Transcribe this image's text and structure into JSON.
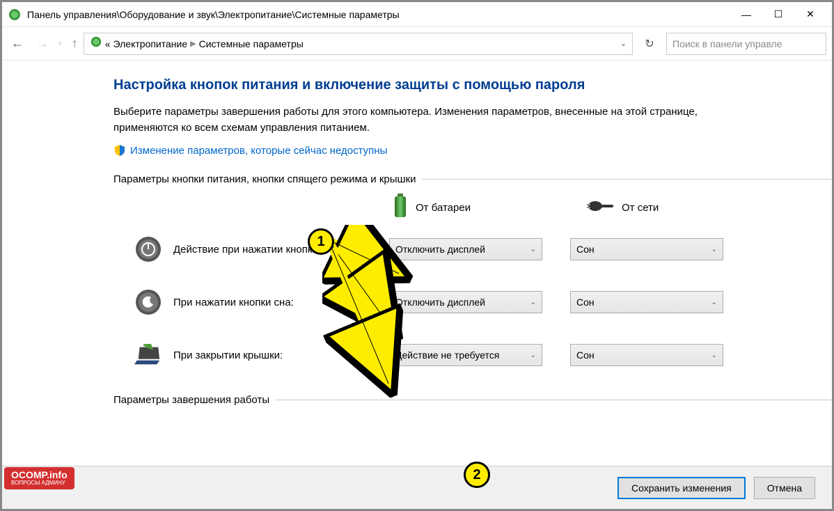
{
  "titlebar": {
    "title": "Панель управления\\Оборудование и звук\\Электропитание\\Системные параметры"
  },
  "navbar": {
    "crumb_prefix": "«",
    "crumb1": "Электропитание",
    "crumb2": "Системные параметры",
    "search_placeholder": "Поиск в панели управле"
  },
  "content": {
    "heading": "Настройка кнопок питания и включение защиты с помощью пароля",
    "description": "Выберите параметры завершения работы для этого компьютера. Изменения параметров, внесенные на этой странице, применяются ко всем схемам управления питанием.",
    "change_link": "Изменение параметров, которые сейчас недоступны",
    "section1_title": "Параметры кнопки питания, кнопки спящего режима и крышки",
    "col_battery": "От батареи",
    "col_plugged": "От сети",
    "rows": [
      {
        "label": "Действие при нажатии кнопки питания:",
        "battery": "Отключить дисплей",
        "plugged": "Сон"
      },
      {
        "label": "При нажатии кнопки сна:",
        "battery": "Отключить дисплей",
        "plugged": "Сон"
      },
      {
        "label": "При закрытии крышки:",
        "battery": "Действие не требуется",
        "plugged": "Сон"
      }
    ],
    "section2_title": "Параметры завершения работы"
  },
  "buttons": {
    "save": "Сохранить изменения",
    "cancel": "Отмена"
  },
  "annotations": {
    "badge1": "1",
    "badge2": "2"
  },
  "logo": {
    "line1": "OCOMP.info",
    "line2": "ВОПРОСЫ АДМИНУ"
  }
}
